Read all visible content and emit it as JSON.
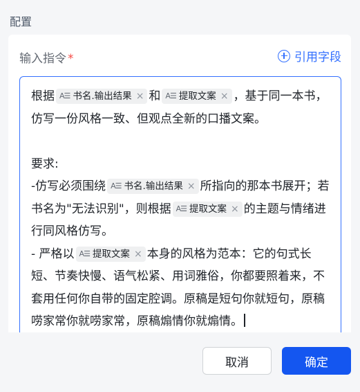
{
  "section": {
    "title": "配置"
  },
  "field": {
    "label": "输入指令",
    "required_mark": "*"
  },
  "ref": {
    "label": "引用字段",
    "icon": "plus-circle-icon"
  },
  "editor": {
    "t1": "根据",
    "chip1": "书名.输出结果",
    "t2": "和",
    "chip2": "提取文案",
    "t3": "，基于同一本书，仿写一份风格一致、但观点全新的口播文案。",
    "t4": "要求:",
    "t5": "-仿写必须围绕",
    "chip3": "书名.输出结果",
    "t6": "所指向的那本书展开；若书名为\"无法识别\"，则根据",
    "chip4": "提取文案",
    "t7": "的主题与情绪进行同风格仿写。",
    "t8": "- 严格以",
    "chip5": "提取文案",
    "t9": "本身的风格为范本：它的句式长短、节奏快慢、语气松紧、用词雅俗，你都要照着来，不套用任何你自带的固定腔调。原稿是短句你就短句，原稿唠家常你就唠家常，原稿煽情你就煽情。",
    "chip_icon_text": "A☰",
    "chip_close": "×"
  },
  "footer": {
    "cancel_label": "取消",
    "ok_label": "确定"
  },
  "colors": {
    "accent": "#3370ff",
    "primary_button": "#1456f0",
    "required": "#f54a45"
  }
}
